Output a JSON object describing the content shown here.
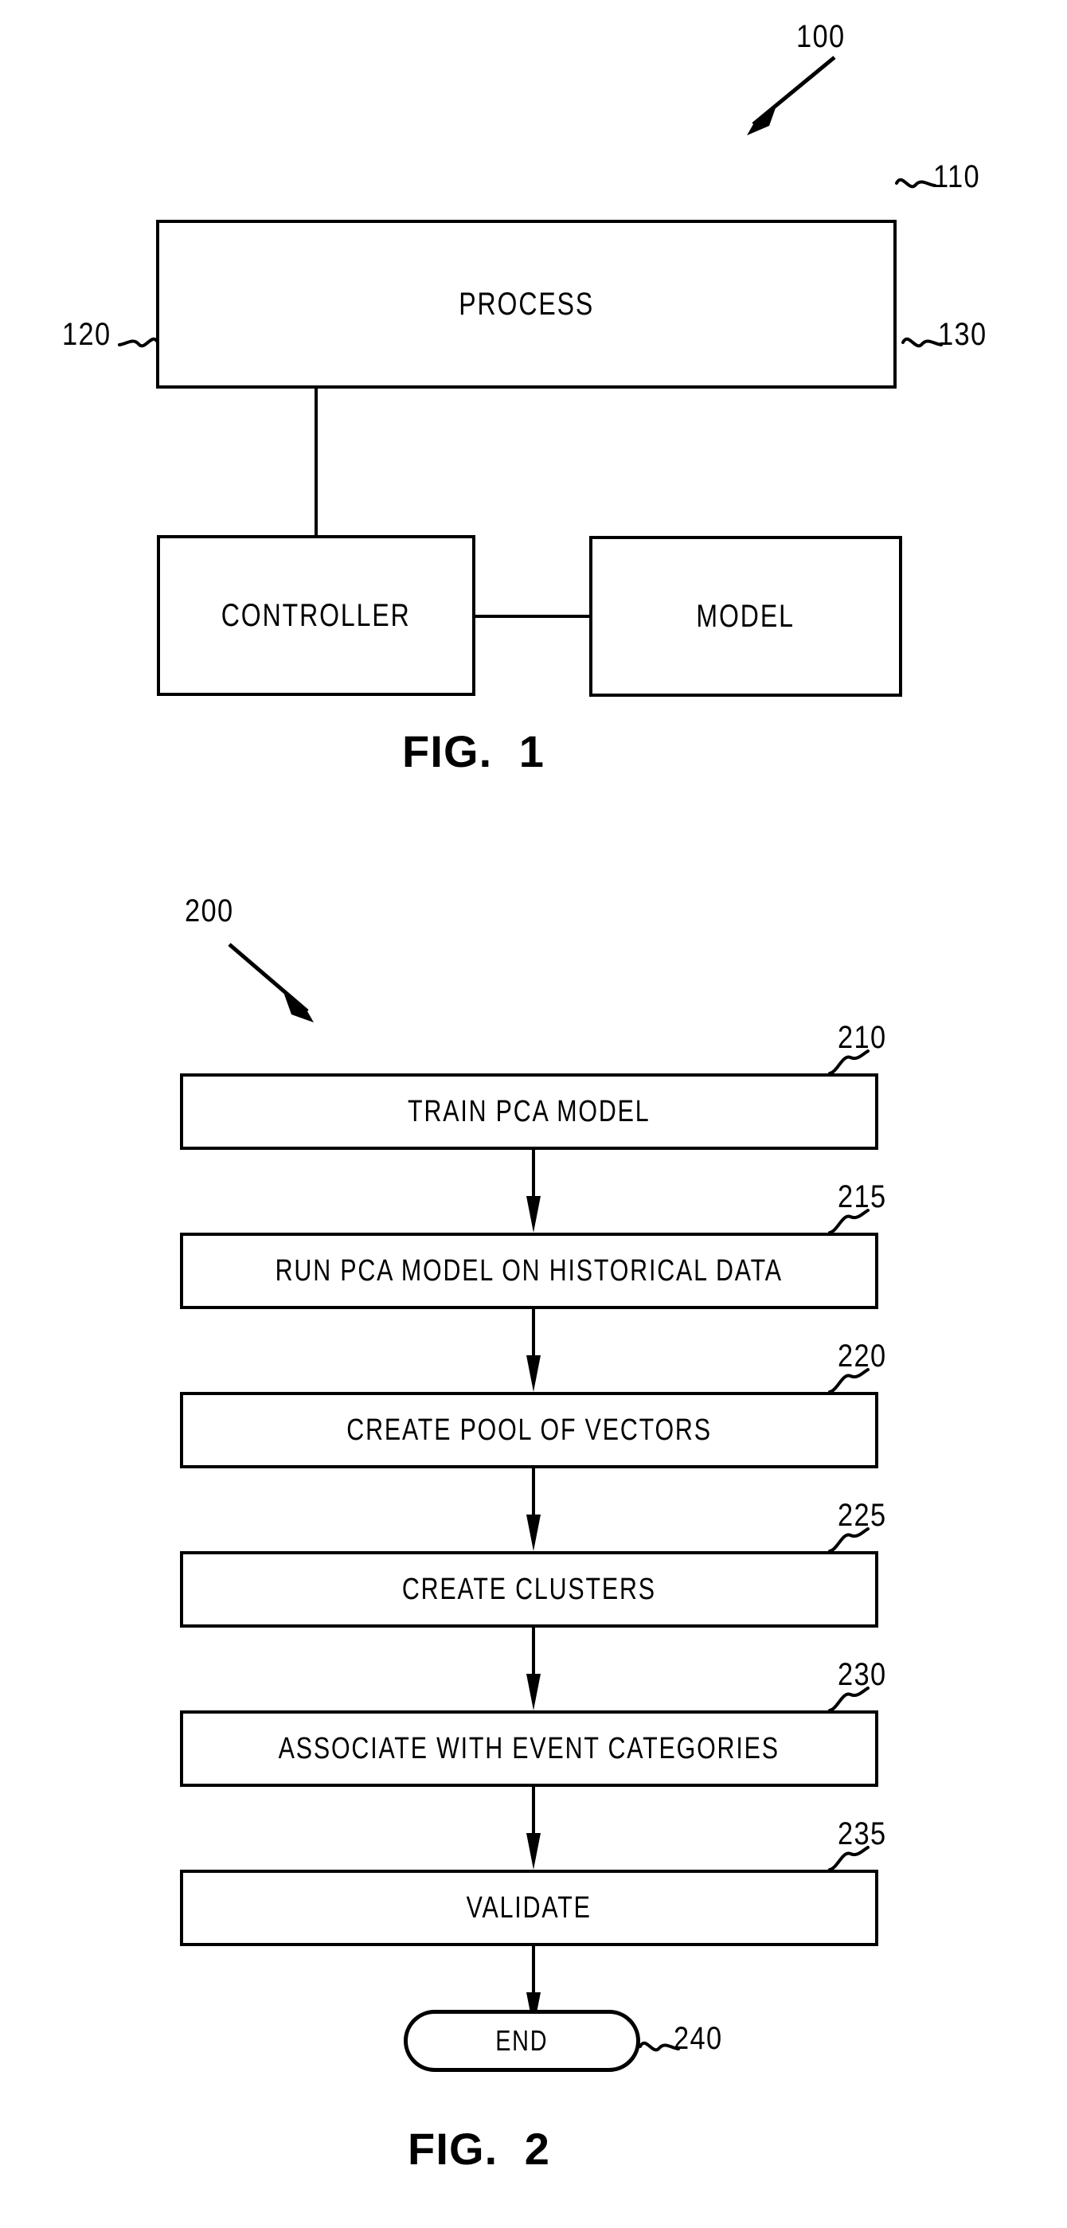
{
  "figures": [
    {
      "id": "figure-1",
      "caption": "FIG.  1",
      "assembly_ref": "100",
      "nodes": [
        {
          "key": "process",
          "label": "PROCESS",
          "ref": "110"
        },
        {
          "key": "controller",
          "label": "CONTROLLER",
          "ref": "120"
        },
        {
          "key": "model",
          "label": "MODEL",
          "ref": "130"
        }
      ]
    },
    {
      "id": "figure-2",
      "caption": "FIG.  2",
      "assembly_ref": "200",
      "nodes": [
        {
          "key": "step-210",
          "label": "TRAIN PCA MODEL",
          "ref": "210"
        },
        {
          "key": "step-215",
          "label": "RUN PCA MODEL ON HISTORICAL DATA",
          "ref": "215"
        },
        {
          "key": "step-220",
          "label": "CREATE POOL OF VECTORS",
          "ref": "220"
        },
        {
          "key": "step-225",
          "label": "CREATE CLUSTERS",
          "ref": "225"
        },
        {
          "key": "step-230",
          "label": "ASSOCIATE WITH EVENT CATEGORIES",
          "ref": "230"
        },
        {
          "key": "step-235",
          "label": "VALIDATE",
          "ref": "235"
        },
        {
          "key": "step-240",
          "label": "END",
          "ref": "240"
        }
      ]
    }
  ],
  "fig1": {
    "ref_100": "100",
    "process_label": "PROCESS",
    "process_ref": "110",
    "controller_label": "CONTROLLER",
    "controller_ref": "120",
    "model_label": "MODEL",
    "model_ref": "130",
    "caption": "FIG.  1"
  },
  "fig2": {
    "ref_200": "200",
    "caption": "FIG.  2",
    "steps": [
      {
        "label": "TRAIN PCA MODEL",
        "ref": "210"
      },
      {
        "label": "RUN PCA MODEL ON HISTORICAL DATA",
        "ref": "215"
      },
      {
        "label": "CREATE POOL OF VECTORS",
        "ref": "220"
      },
      {
        "label": "CREATE CLUSTERS",
        "ref": "225"
      },
      {
        "label": "ASSOCIATE WITH EVENT CATEGORIES",
        "ref": "230"
      },
      {
        "label": "VALIDATE",
        "ref": "235"
      }
    ],
    "end_label": "END",
    "end_ref": "240"
  },
  "style": {
    "ink": "#000000",
    "paper": "#ffffff"
  }
}
